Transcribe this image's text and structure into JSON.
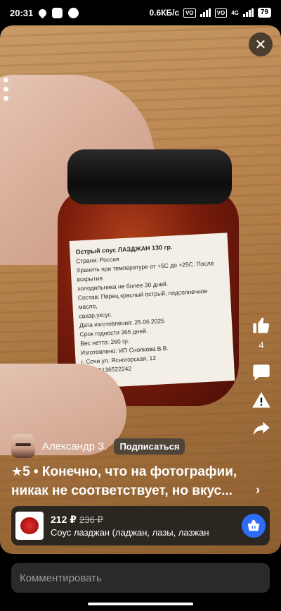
{
  "status_bar": {
    "time": "20:31",
    "network_speed": "0.6КБ/с",
    "network_type": "4G",
    "battery": "79",
    "vo_label": "VO"
  },
  "photo": {
    "label": {
      "title": "Острый соус ЛАЗДЖАН 130 гр.",
      "lines": [
        "Страна: Россия",
        "Хранить при температуре от +5С до +25С. После вскрытия",
        "холодильника не более 30 дней.",
        "Состав: Перец красный острый, подсолнечное масло,",
        "сахар,уксус.",
        "Дата изготовления: 25.06.2025",
        "Срок годности 365 дней.",
        "Вес нетто: 260 гр.",
        "Изготовлено: ИП Снопкова В.В.",
        "г. Сочи ул. Ясногорская, 12",
        "Тел: 89136522242"
      ]
    }
  },
  "actions": {
    "like_count": "4"
  },
  "author": {
    "name": "Александр З.",
    "subscribe_label": "Подписаться"
  },
  "review": {
    "star": "★",
    "rating": "5",
    "text": " • Конечно, что на фотографии, никак не соответствует, но вкус...",
    "more_chevron": "›"
  },
  "product": {
    "price": "212 ₽",
    "old_price": "236 ₽",
    "name": "Соус лазджан (ладжан, лазы, лазжан"
  },
  "comment": {
    "placeholder": "Комментировать"
  },
  "colors": {
    "accent": "#2f6cf5",
    "card_bg": "#1e1e1e"
  },
  "icons": [
    "close-icon",
    "like-icon",
    "comment-icon",
    "report-icon",
    "share-icon",
    "cart-icon",
    "star-icon"
  ]
}
